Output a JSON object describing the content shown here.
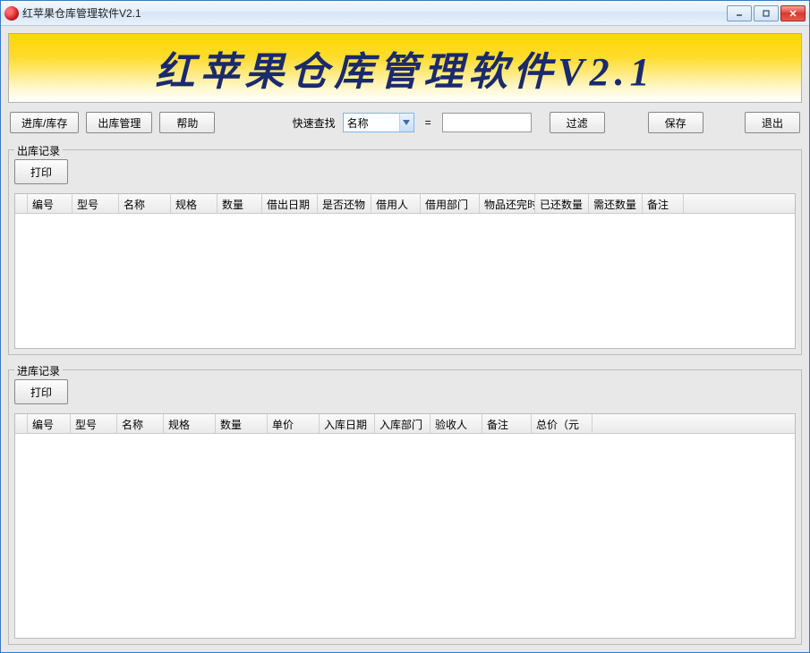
{
  "window": {
    "title": "红苹果仓库管理软件V2.1"
  },
  "banner": {
    "text": "红苹果仓库管理软件V2.1"
  },
  "toolbar": {
    "stock_in_btn": "进库/库存",
    "stock_out_btn": "出库管理",
    "help_btn": "帮助",
    "quick_search_label": "快速查找",
    "search_field_options": [
      "名称"
    ],
    "search_field_selected": "名称",
    "equals": "=",
    "search_value": "",
    "filter_btn": "过滤",
    "save_btn": "保存",
    "exit_btn": "退出"
  },
  "out_panel": {
    "label": "出库记录",
    "print_btn": "打印",
    "columns": [
      "编号",
      "型号",
      "名称",
      "规格",
      "数量",
      "借出日期",
      "是否还物",
      "借用人",
      "借用部门",
      "物品还完时",
      "已还数量",
      "需还数量",
      "备注"
    ]
  },
  "in_panel": {
    "label": "进库记录",
    "print_btn": "打印",
    "columns": [
      "编号",
      "型号",
      "名称",
      "规格",
      "数量",
      "单价",
      "入库日期",
      "入库部门",
      "验收人",
      "备注",
      "总价（元"
    ]
  }
}
